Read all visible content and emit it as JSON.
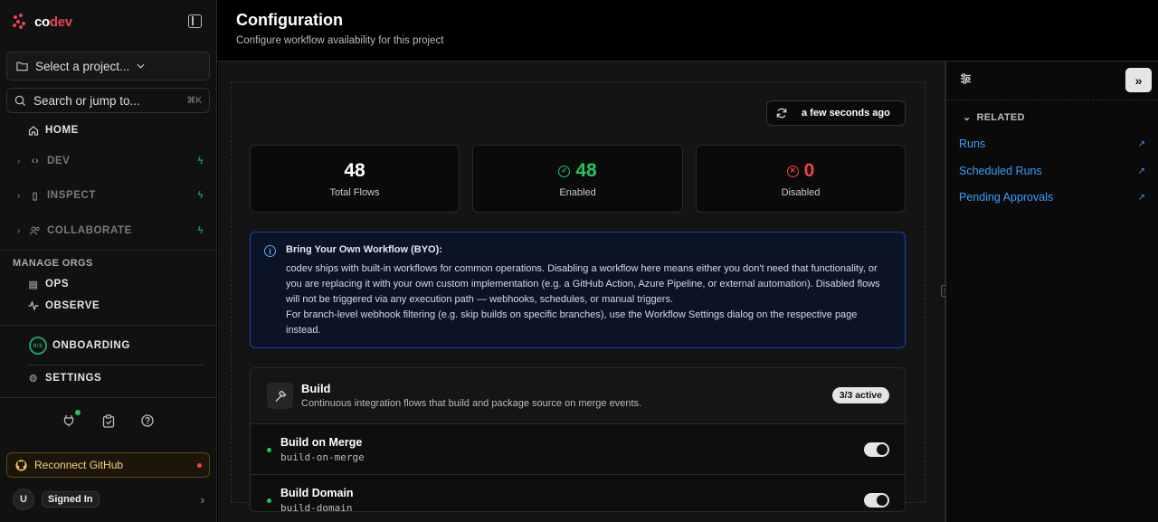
{
  "brand": {
    "prefix": "co",
    "suffix": "dev"
  },
  "sidebar": {
    "project_placeholder": "Select a project...",
    "search_placeholder": "Search or jump to...",
    "search_shortcut": "⌘K",
    "home": "HOME",
    "dev": "DEV",
    "inspect": "INSPECT",
    "collaborate": "COLLABORATE",
    "manage_orgs": "MANAGE ORGS",
    "ops": "OPS",
    "observe": "OBSERVE",
    "onboarding_progress": "8/8",
    "onboarding": "ONBOARDING",
    "settings": "SETTINGS",
    "reconnect_github": "Reconnect GitHub",
    "user_initial": "U",
    "signed_in": "Signed In"
  },
  "header": {
    "title": "Configuration",
    "subtitle": "Configure workflow availability for this project"
  },
  "main": {
    "refresh_time": "a few seconds ago",
    "stats": [
      {
        "value": "48",
        "label": "Total Flows"
      },
      {
        "value": "48",
        "label": "Enabled"
      },
      {
        "value": "0",
        "label": "Disabled"
      }
    ],
    "info": {
      "title": "Bring Your Own Workflow (BYO):",
      "body": "codev ships with built-in workflows for common operations. Disabling a workflow here means either you don't need that functionality, or you are replacing it with your own custom implementation (e.g. a GitHub Action, Azure Pipeline, or external automation). Disabled flows will not be triggered via any execution path — webhooks, schedules, or manual triggers.",
      "body2": "For branch-level webhook filtering (e.g. skip builds on specific branches), use the Workflow Settings dialog on the respective page instead."
    },
    "group": {
      "title": "Build",
      "description": "Continuous integration flows that build and package source on merge events.",
      "badge": "3/3 active",
      "flows": [
        {
          "name": "Build on Merge",
          "slug": "build-on-merge"
        },
        {
          "name": "Build Domain",
          "slug": "build-domain"
        }
      ]
    }
  },
  "right_panel": {
    "related_label": "RELATED",
    "links": [
      "Runs",
      "Scheduled Runs",
      "Pending Approvals"
    ]
  },
  "colors": {
    "accent": "#e5484d",
    "enabled": "#22c55e",
    "disabled": "#ef4444",
    "link": "#3b9eff"
  }
}
